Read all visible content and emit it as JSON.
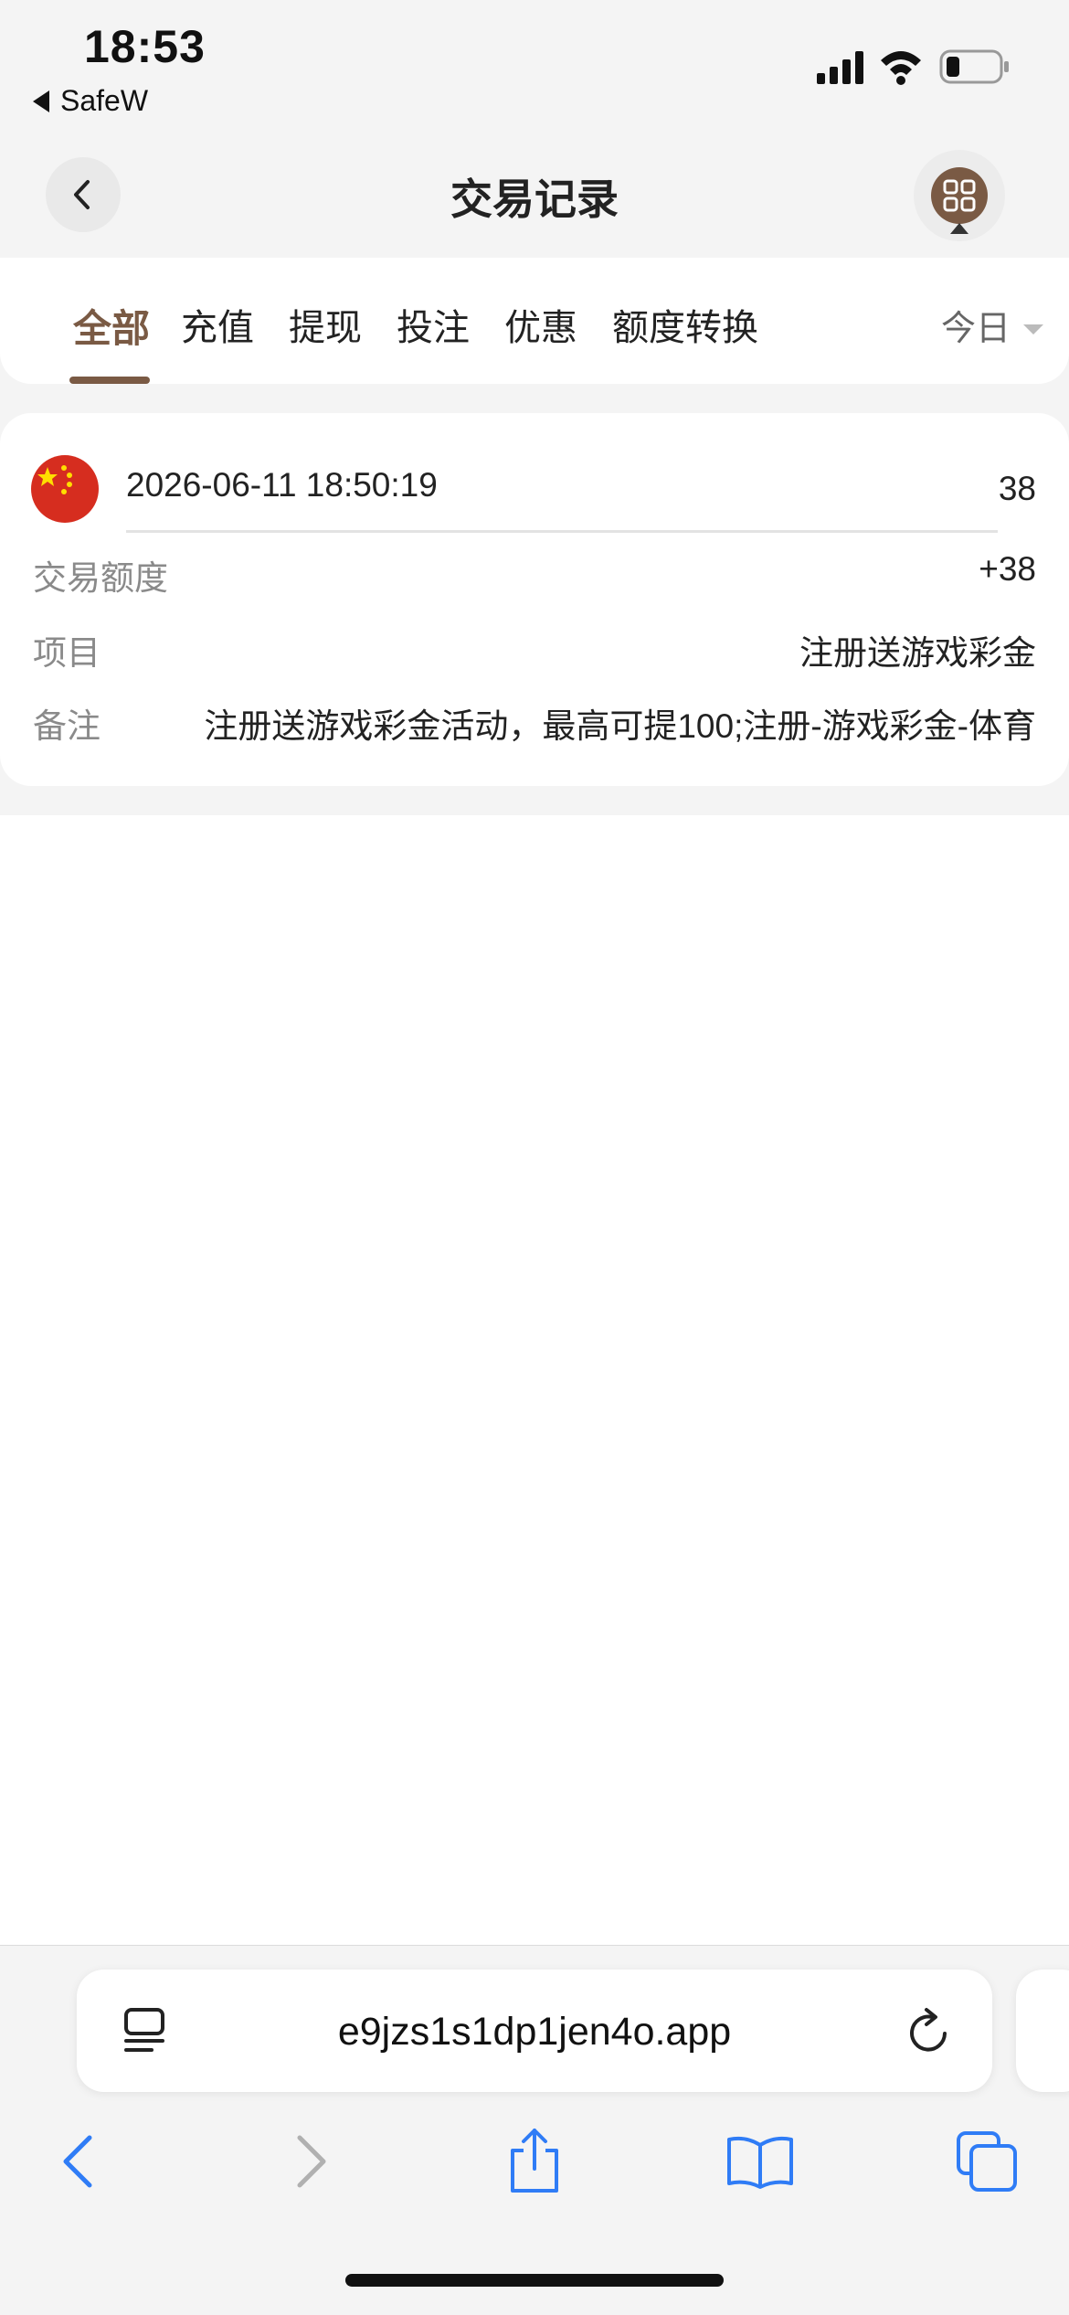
{
  "status_bar": {
    "time": "18:53",
    "back_app": "SafeW",
    "icons": [
      "signal-icon",
      "wifi-icon",
      "battery-icon"
    ]
  },
  "header": {
    "title": "交易记录",
    "back_icon": "chevron-left-icon",
    "menu_icon": "grid-menu-icon"
  },
  "tabs": {
    "items": [
      {
        "label": "全部",
        "active": true
      },
      {
        "label": "充值",
        "active": false
      },
      {
        "label": "提现",
        "active": false
      },
      {
        "label": "投注",
        "active": false
      },
      {
        "label": "优惠",
        "active": false
      },
      {
        "label": "额度转换",
        "active": false
      }
    ],
    "date_filter": "今日"
  },
  "record": {
    "flag_icon": "china-flag-icon",
    "time": "2026-06-11 18:50:19",
    "amount": "38",
    "rows": [
      {
        "label": "交易额度",
        "value": "+38"
      },
      {
        "label": "项目",
        "value": "注册送游戏彩金"
      },
      {
        "label": "备注",
        "value": "注册送游戏彩金活动，最高可提100;注册-游戏彩金-体育"
      }
    ]
  },
  "browser": {
    "url": "e9jzs1s1dp1jen4o.app",
    "nav": [
      "back-icon",
      "forward-icon",
      "share-icon",
      "bookmarks-icon",
      "tabs-icon"
    ]
  },
  "colors": {
    "accent": "#7a5a44",
    "ios_blue": "#2f7cf6",
    "background_gray": "#f4f4f4"
  }
}
